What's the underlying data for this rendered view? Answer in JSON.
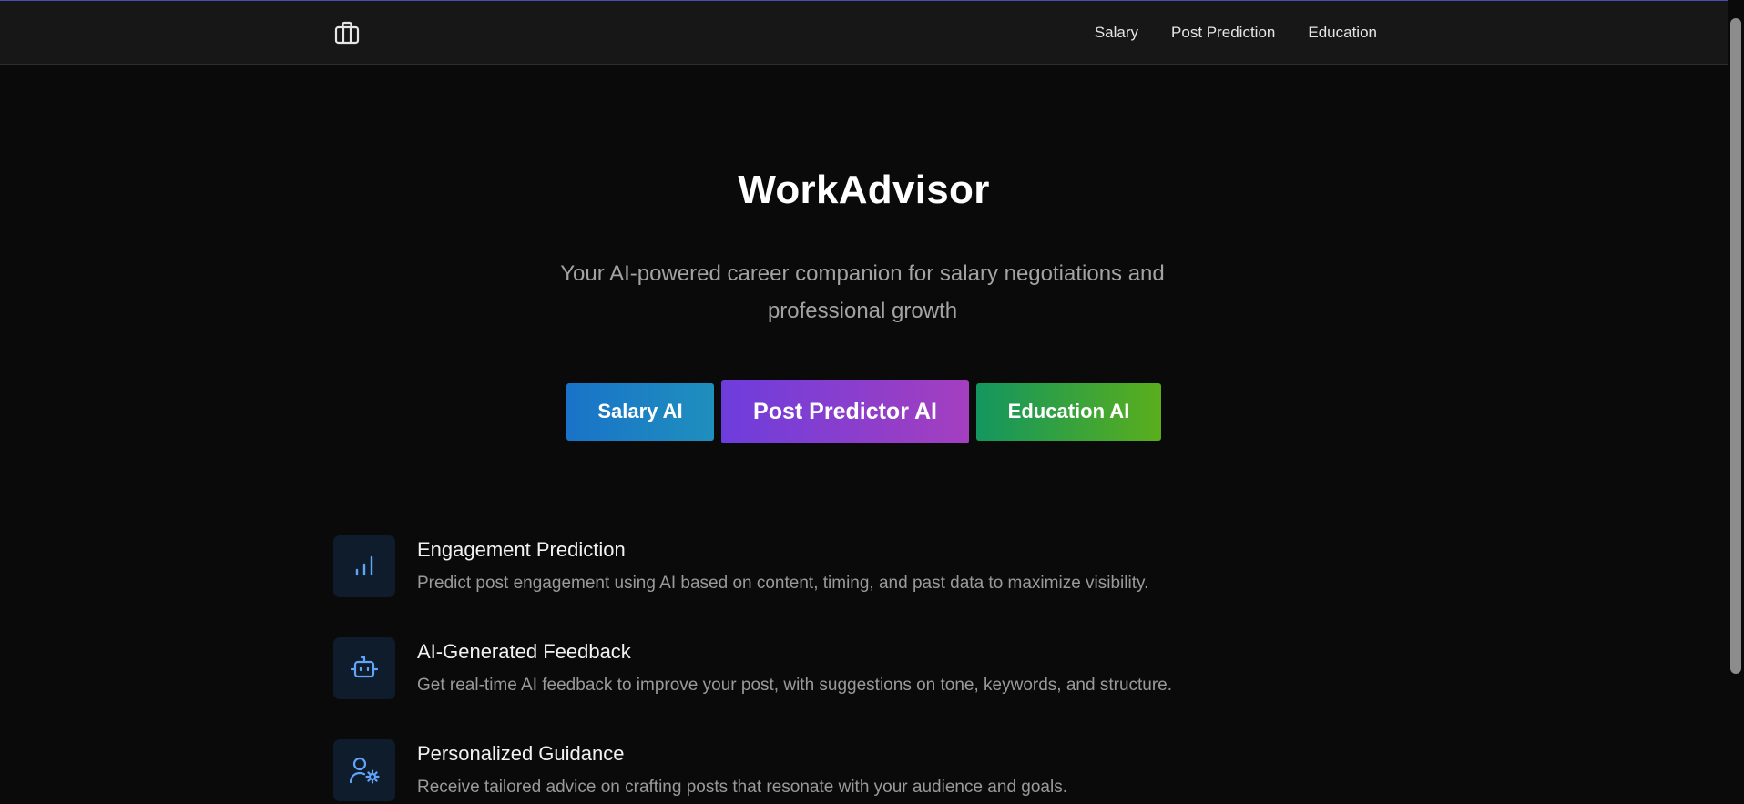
{
  "nav": {
    "logo_icon": "briefcase-icon",
    "links": [
      "Salary",
      "Post Prediction",
      "Education"
    ]
  },
  "hero": {
    "title": "WorkAdvisor",
    "subtitle": "Your AI-powered career companion for salary negotiations and professional growth"
  },
  "cta": {
    "salary": "Salary AI",
    "post": "Post Predictor AI",
    "education": "Education AI"
  },
  "features": [
    {
      "icon": "bar-chart-icon",
      "title": "Engagement Prediction",
      "description": "Predict post engagement using AI based on content, timing, and past data to maximize visibility."
    },
    {
      "icon": "bot-icon",
      "title": "AI-Generated Feedback",
      "description": "Get real-time AI feedback to improve your post, with suggestions on tone, keywords, and structure."
    },
    {
      "icon": "user-cog-icon",
      "title": "Personalized Guidance",
      "description": "Receive tailored advice on crafting posts that resonate with your audience and goals."
    }
  ],
  "colors": {
    "background": "#0a0a0a",
    "navbar": "#171717",
    "icon_accent": "#60a5fa",
    "salary_gradient": [
      "#1973c8",
      "#1f8fbd"
    ],
    "post_gradient": [
      "#6d3ddc",
      "#a43fbf"
    ],
    "education_gradient": [
      "#13965f",
      "#5aae1c"
    ]
  }
}
